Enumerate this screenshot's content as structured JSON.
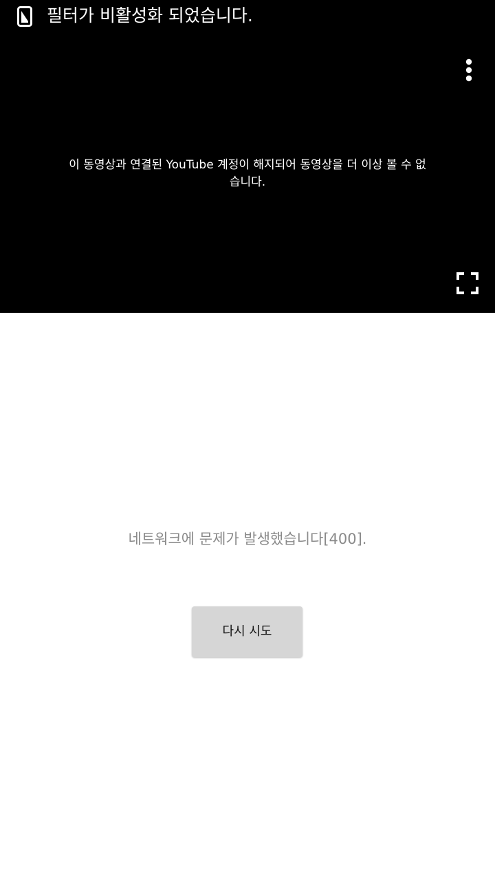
{
  "status_bar": {
    "icon": "filter-off-icon",
    "text": "필터가 비활성화 되었습니다."
  },
  "player": {
    "message": "이 동영상과 연결된 YouTube 계정이 해지되어 동영상을 더 이상 볼 수 없습니다.",
    "more_icon": "more-vert-icon",
    "fullscreen_icon": "fullscreen-icon",
    "background": "#000000"
  },
  "error": {
    "message": "네트워크에 문제가 발생했습니다[400].",
    "retry_label": "다시 시도"
  }
}
